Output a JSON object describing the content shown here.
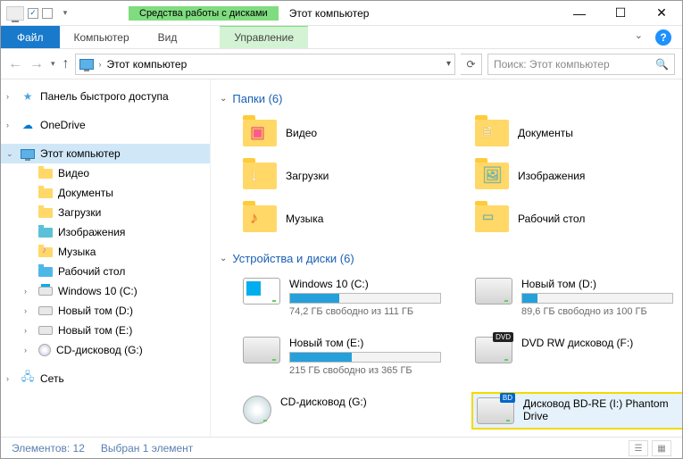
{
  "titlebar": {
    "context_tab_top": "Средства работы с дисками",
    "title": "Этот компьютер"
  },
  "ribbon": {
    "file": "Файл",
    "tabs": [
      "Компьютер",
      "Вид"
    ],
    "context_tab": "Управление"
  },
  "address": {
    "text": "Этот компьютер"
  },
  "search": {
    "placeholder": "Поиск: Этот компьютер"
  },
  "navpane": {
    "quick_access": "Панель быстрого доступа",
    "onedrive": "OneDrive",
    "this_pc": "Этот компьютер",
    "this_pc_children": [
      "Видео",
      "Документы",
      "Загрузки",
      "Изображения",
      "Музыка",
      "Рабочий стол",
      "Windows 10 (C:)",
      "Новый том (D:)",
      "Новый том (E:)",
      "CD-дисковод (G:)"
    ],
    "network": "Сеть"
  },
  "content": {
    "folders_header": "Папки (6)",
    "folders": [
      {
        "name": "Видео",
        "kind": "video",
        "glyph": "▣"
      },
      {
        "name": "Документы",
        "kind": "docs",
        "glyph": "🗎"
      },
      {
        "name": "Загрузки",
        "kind": "downloads",
        "glyph": "↓"
      },
      {
        "name": "Изображения",
        "kind": "pics",
        "glyph": "🖼"
      },
      {
        "name": "Музыка",
        "kind": "music",
        "glyph": "♪"
      },
      {
        "name": "Рабочий стол",
        "kind": "desktop",
        "glyph": "▭"
      }
    ],
    "drives_header": "Устройства и диски (6)",
    "drives": [
      {
        "name": "Windows 10 (C:)",
        "kind": "win",
        "free": "74,2 ГБ свободно из 111 ГБ",
        "fill_pct": 33
      },
      {
        "name": "Новый том (D:)",
        "kind": "hdd",
        "free": "89,6 ГБ свободно из 100 ГБ",
        "fill_pct": 10
      },
      {
        "name": "Новый том (E:)",
        "kind": "hdd",
        "free": "215 ГБ свободно из 365 ГБ",
        "fill_pct": 41
      },
      {
        "name": "DVD RW дисковод (F:)",
        "kind": "dvd"
      },
      {
        "name": "CD-дисковод (G:)",
        "kind": "cd"
      },
      {
        "name": "Дисковод BD-RE (I:) Phantom Drive",
        "kind": "bd",
        "highlighted": true
      }
    ]
  },
  "statusbar": {
    "count": "Элементов: 12",
    "selection": "Выбран 1 элемент"
  }
}
